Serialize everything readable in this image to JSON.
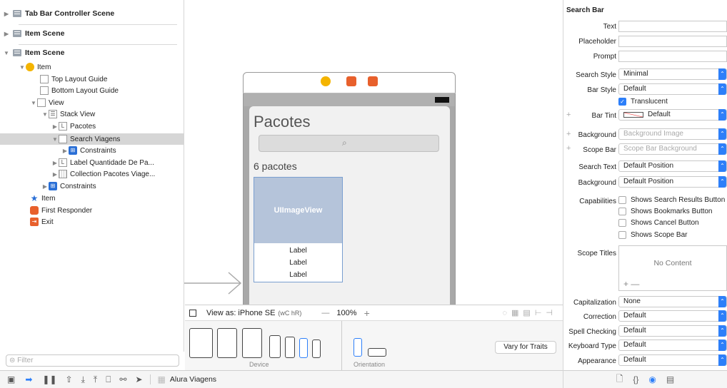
{
  "outline": {
    "scenes": [
      "Tab Bar Controller Scene",
      "Item Scene",
      "Item Scene"
    ],
    "tree": [
      "Item",
      "Top Layout Guide",
      "Bottom Layout Guide",
      "View",
      "Stack View",
      "Pacotes",
      "Search Viagens",
      "Constraints",
      "Label Quantidade De Pa...",
      "Collection Pacotes Viage...",
      "Constraints",
      "Item",
      "First Responder",
      "Exit"
    ],
    "filter_placeholder": "Filter"
  },
  "canvas": {
    "title": "Pacotes",
    "count_label": "6 pacotes",
    "image_view": "UIImageView",
    "labels": [
      "Label",
      "Label",
      "Label"
    ]
  },
  "viewas": {
    "title": "View as: iPhone SE",
    "traits": "(wC hR)",
    "zoom": "100%",
    "minus": "—",
    "plus": "+"
  },
  "devices": {
    "device_label": "Device",
    "orientation_label": "Orientation",
    "vary_button": "Vary for Traits"
  },
  "bottombar": {
    "scheme": "Alura Viagens"
  },
  "inspector": {
    "section": "Search Bar",
    "text_label": "Text",
    "placeholder_label": "Placeholder",
    "prompt_label": "Prompt",
    "search_style_label": "Search Style",
    "search_style": "Minimal",
    "bar_style_label": "Bar Style",
    "bar_style": "Default",
    "translucent": "Translucent",
    "bar_tint_label": "Bar Tint",
    "bar_tint": "Default",
    "background_label": "Background",
    "background_ph": "Background Image",
    "scope_bar_label": "Scope Bar",
    "scope_bar_ph": "Scope Bar Background",
    "search_text_label": "Search Text",
    "search_text": "Default Position",
    "background2_label": "Background",
    "background2": "Default Position",
    "capabilities_label": "Capabilities",
    "cap1": "Shows Search Results Button",
    "cap2": "Shows Bookmarks Button",
    "cap3": "Shows Cancel Button",
    "cap4": "Shows Scope Bar",
    "scope_titles_label": "Scope Titles",
    "no_content": "No Content",
    "cap_label": "Capitalization",
    "cap_value": "None",
    "correction_label": "Correction",
    "correction_value": "Default",
    "spell_label": "Spell Checking",
    "spell_value": "Default",
    "keyboard_label": "Keyboard Type",
    "keyboard_value": "Default",
    "appearance_label": "Appearance",
    "appearance_value": "Default"
  },
  "colors": {
    "accent": "#2d7ff9",
    "selection": "#d6d6d6",
    "image_view": "#b5c4da"
  }
}
